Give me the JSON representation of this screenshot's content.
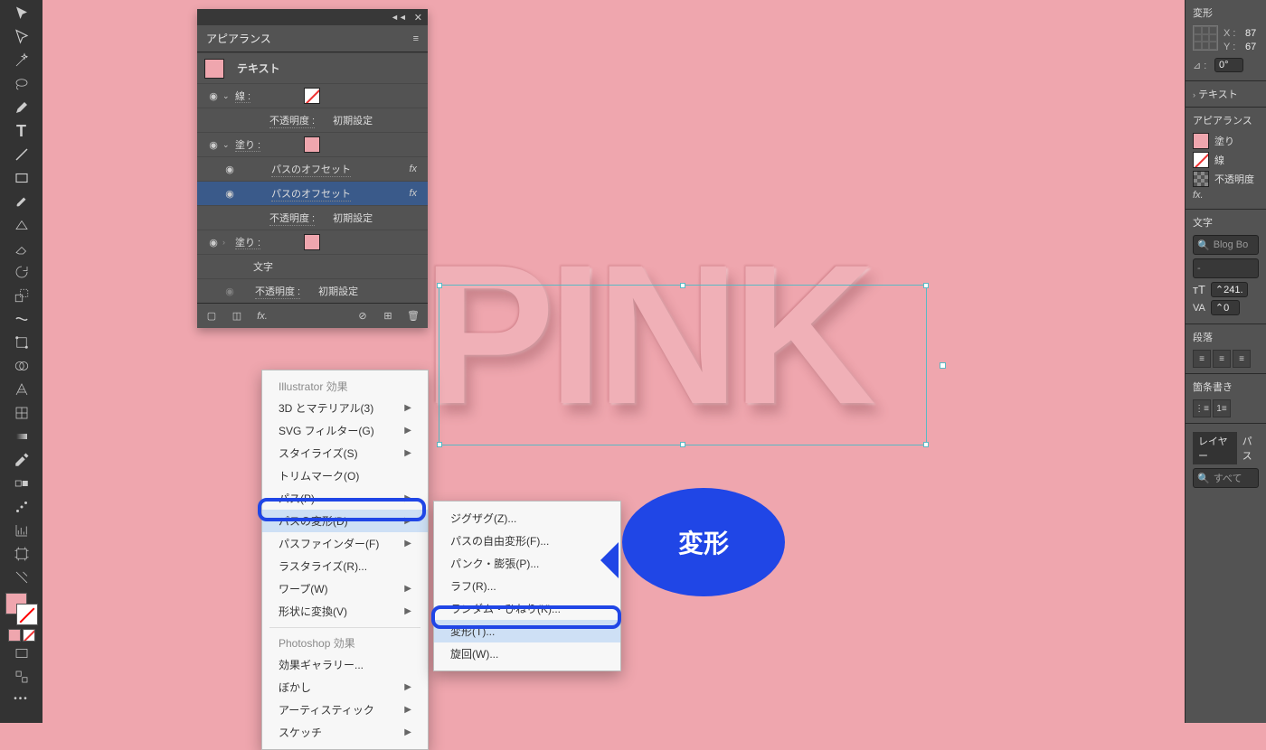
{
  "toolbar": {
    "tools": [
      "selection",
      "direct-selection",
      "magic-wand",
      "lasso",
      "pen",
      "curvature",
      "type",
      "line",
      "rectangle",
      "brush",
      "shaper",
      "eraser",
      "rotate",
      "scale",
      "width",
      "free-transform",
      "shape-builder",
      "perspective",
      "mesh",
      "gradient",
      "eyedropper",
      "blend",
      "symbol-spray",
      "graph",
      "artboard",
      "slice",
      "hand",
      "zoom"
    ]
  },
  "canvas": {
    "text": "PINK"
  },
  "appearance": {
    "title": "アピアランス",
    "thumb_label": "テキスト",
    "stroke_label": "線 :",
    "fill_label": "塗り :",
    "fill2_label": "塗り :",
    "opacity_label": "不透明度 :",
    "opacity_value": "初期設定",
    "offset1": "パスのオフセット",
    "offset2": "パスのオフセット",
    "char_label": "文字",
    "fx_indicator": "fx"
  },
  "menu1": {
    "header1": "Illustrator 効果",
    "items1": [
      {
        "label": "3D とマテリアル(3)",
        "sub": true
      },
      {
        "label": "SVG フィルター(G)",
        "sub": true
      },
      {
        "label": "スタイライズ(S)",
        "sub": true
      },
      {
        "label": "トリムマーク(O)",
        "sub": false
      },
      {
        "label": "パス(P)",
        "sub": true
      },
      {
        "label": "パスの変形(D)",
        "sub": true,
        "hl": true
      },
      {
        "label": "パスファインダー(F)",
        "sub": true
      },
      {
        "label": "ラスタライズ(R)...",
        "sub": false
      },
      {
        "label": "ワープ(W)",
        "sub": true
      },
      {
        "label": "形状に変換(V)",
        "sub": true
      }
    ],
    "header2": "Photoshop 効果",
    "items2": [
      {
        "label": "効果ギャラリー...",
        "sub": false
      },
      {
        "label": "ぼかし",
        "sub": true
      },
      {
        "label": "アーティスティック",
        "sub": true
      },
      {
        "label": "スケッチ",
        "sub": true
      }
    ]
  },
  "menu2": {
    "items": [
      {
        "label": "ジグザグ(Z)..."
      },
      {
        "label": "パスの自由変形(F)..."
      },
      {
        "label": "パンク・膨張(P)..."
      },
      {
        "label": "ラフ(R)..."
      },
      {
        "label": "ランダム・ひねり(K)..."
      },
      {
        "label": "変形(T)...",
        "hl": true
      },
      {
        "label": "旋回(W)..."
      }
    ]
  },
  "bubble": {
    "text": "変形"
  },
  "right": {
    "transform": {
      "title": "変形",
      "x_label": "X :",
      "x": "87",
      "y_label": "Y :",
      "y": "67",
      "angle_label": "⊿ :",
      "angle": "0°"
    },
    "text_more": "テキスト",
    "appearance": {
      "title": "アピアランス",
      "fill_label": "塗り",
      "stroke_label": "線",
      "opacity_label": "不透明度"
    },
    "char": {
      "title": "文字",
      "font": "Blog Bo",
      "style": "-",
      "size": "241.",
      "kern": "0"
    },
    "para": {
      "title": "段落"
    },
    "bullet": {
      "title": "箇条書き"
    },
    "layer": {
      "tab1": "レイヤー",
      "tab2": "パス",
      "search": "すべて"
    }
  }
}
